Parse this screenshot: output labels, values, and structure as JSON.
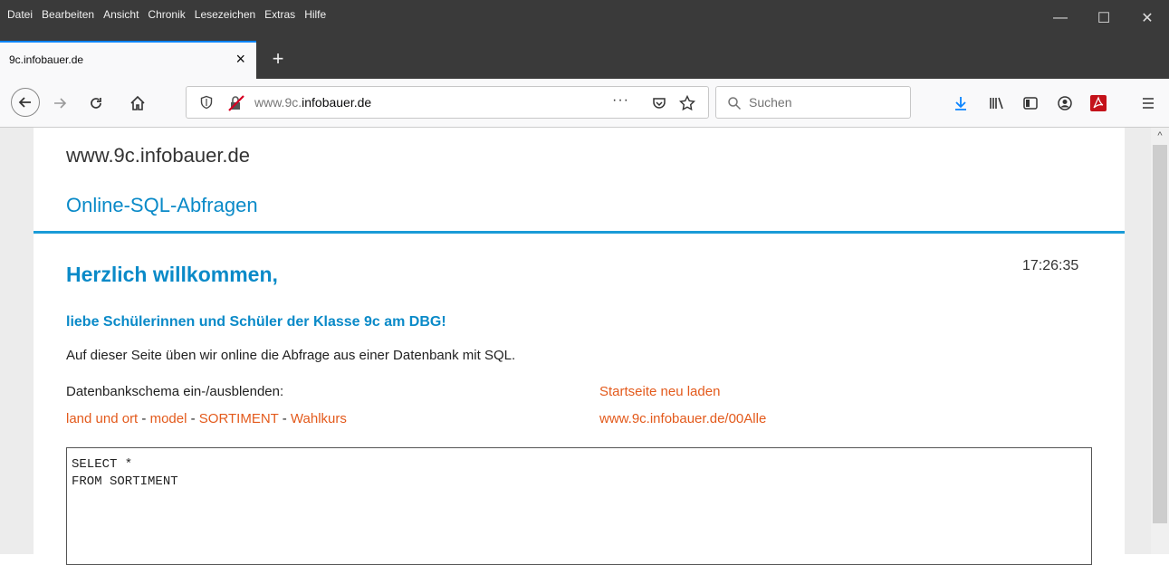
{
  "menu": [
    "Datei",
    "Bearbeiten",
    "Ansicht",
    "Chronik",
    "Lesezeichen",
    "Extras",
    "Hilfe"
  ],
  "tab": {
    "title": "9c.infobauer.de",
    "close": "×",
    "new_tab": "+"
  },
  "window": {
    "minimize": "—",
    "maximize": "☐",
    "close": "✕"
  },
  "url": {
    "prefix": "www.9c.",
    "domain": "infobauer.de"
  },
  "search": {
    "placeholder": "Suchen"
  },
  "page": {
    "site_url": "www.9c.infobauer.de",
    "site_subtitle": "Online-SQL-Abfragen",
    "clock": "17:26:35",
    "welcome": "Herzlich willkommen,",
    "dear": "liebe Schülerinnen und Schüler der Klasse 9c am DBG!",
    "intro": "Auf dieser Seite üben wir online die Abfrage aus einer Datenbank mit SQL.",
    "schema_label": "Datenbankschema ein-/ausblenden:",
    "schema_links": [
      "land und ort",
      "model",
      "SORTIMENT",
      "Wahlkurs"
    ],
    "schema_sep": " - ",
    "reload": "Startseite neu laden",
    "alle": "www.9c.infobauer.de/00Alle",
    "sql": "SELECT *\nFROM SORTIMENT"
  },
  "colors": {
    "accent": "#1a9bd7",
    "link": "#e35a1c",
    "heading": "#0a8ac8"
  }
}
